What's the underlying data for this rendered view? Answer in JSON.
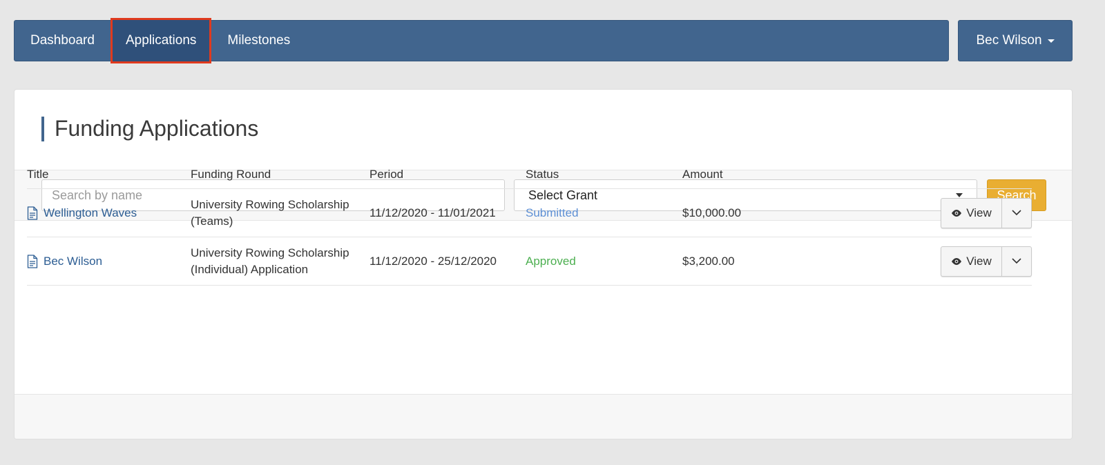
{
  "nav": {
    "items": [
      {
        "label": "Dashboard"
      },
      {
        "label": "Applications"
      },
      {
        "label": "Milestones"
      }
    ],
    "user": "Bec Wilson"
  },
  "page": {
    "title": "Funding Applications"
  },
  "filters": {
    "search_placeholder": "Search by name",
    "grant_select": "Select Grant",
    "search_button": "Search"
  },
  "table": {
    "headers": [
      "Title",
      "Funding Round",
      "Period",
      "Status",
      "Amount"
    ],
    "rows": [
      {
        "title": "Wellington Waves",
        "round_line1": "University Rowing Scholarship",
        "round_line2": "(Teams)",
        "period": "11/12/2020 - 11/01/2021",
        "status": "Submitted",
        "amount": "$10,000.00",
        "view": "View"
      },
      {
        "title": "Bec Wilson",
        "round_line1": "University Rowing Scholarship",
        "round_line2": "(Individual) Application",
        "period": "11/12/2020 - 25/12/2020",
        "status": "Approved",
        "amount": "$3,200.00",
        "view": "View"
      }
    ]
  },
  "colors": {
    "nav": "#41658e",
    "highlight": "#e03a1e",
    "search_button": "#e9ae32",
    "status_submitted": "#5d8fd4",
    "status_approved": "#4caf50"
  }
}
